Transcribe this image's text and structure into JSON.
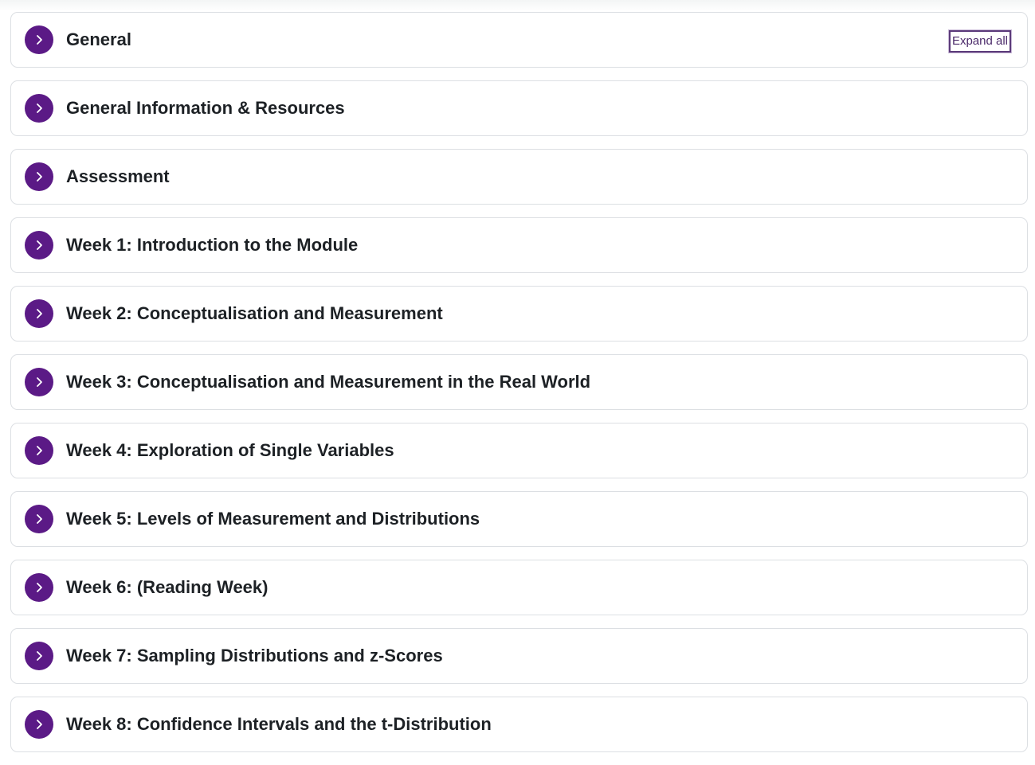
{
  "expand_all_label": "Expand all",
  "accent_color": "#5b1a86",
  "sections": [
    {
      "title": "General"
    },
    {
      "title": "General Information & Resources"
    },
    {
      "title": "Assessment"
    },
    {
      "title": "Week 1: Introduction to the Module"
    },
    {
      "title": "Week 2: Conceptualisation and Measurement"
    },
    {
      "title": "Week 3: Conceptualisation and Measurement in the Real World"
    },
    {
      "title": "Week 4: Exploration of Single Variables"
    },
    {
      "title": "Week 5: Levels of Measurement and Distributions"
    },
    {
      "title": "Week 6: (Reading Week)"
    },
    {
      "title": "Week 7: Sampling Distributions and z-Scores"
    },
    {
      "title": "Week 8: Confidence Intervals and the t-Distribution"
    }
  ]
}
